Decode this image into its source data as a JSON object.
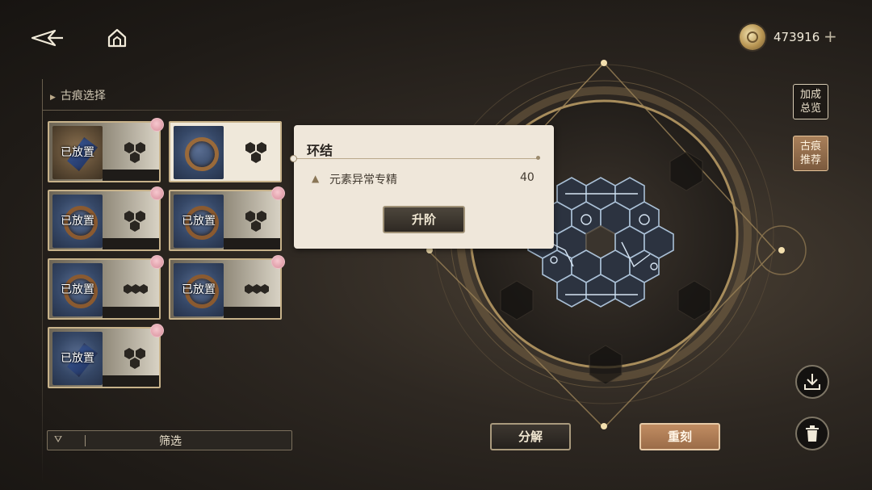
{
  "currency": {
    "amount": "473916",
    "add_label": "+",
    "icon": "coin-icon"
  },
  "nav": {
    "back_icon": "back-arrow-icon",
    "home_icon": "home-icon"
  },
  "panel": {
    "title": "古痕选择",
    "cards": [
      {
        "placed_label": "已放置",
        "style": "gold",
        "relic": "shard"
      },
      {
        "placed_label": "",
        "style": "light-selected",
        "relic": "ring"
      },
      {
        "placed_label": "已放置",
        "style": "blue",
        "relic": "ring"
      },
      {
        "placed_label": "已放置",
        "style": "blue",
        "relic": "ring"
      },
      {
        "placed_label": "已放置",
        "style": "blue",
        "relic": "ring"
      },
      {
        "placed_label": "已放置",
        "style": "blue",
        "relic": "ring"
      },
      {
        "placed_label": "已放置",
        "style": "blue",
        "relic": "shard"
      }
    ],
    "filter_label": "筛选"
  },
  "tooltip": {
    "title": "环结",
    "stat_label": "元素异常专精",
    "stat_value": "40",
    "upgrade_label": "升阶"
  },
  "side_buttons": {
    "bonus_label": "加成\n总览",
    "recommend_label": "古痕\n推荐"
  },
  "bottom_buttons": {
    "dismantle_label": "分解",
    "reforge_label": "重刻"
  },
  "colors": {
    "accent_gold": "#c7b28a",
    "reforge": "#b07d55",
    "background": "#2e2822"
  }
}
